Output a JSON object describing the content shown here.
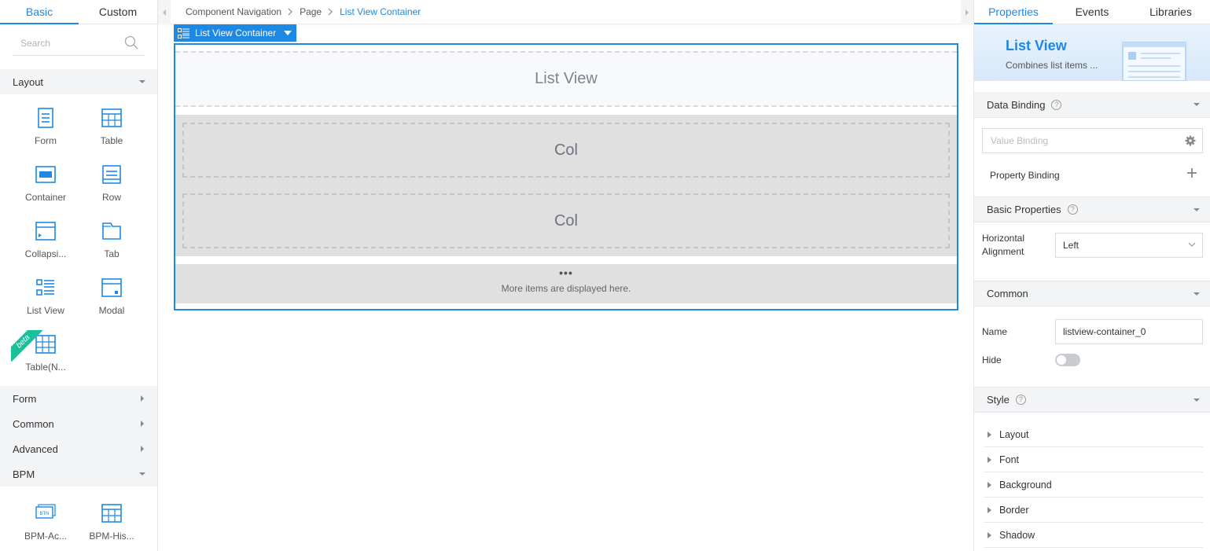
{
  "left": {
    "tabs": [
      {
        "label": "Basic"
      },
      {
        "label": "Custom"
      }
    ],
    "search": {
      "placeholder": "Search",
      "value": ""
    },
    "categories": {
      "layout": "Layout",
      "form": "Form",
      "common": "Common",
      "advanced": "Advanced",
      "bpm": "BPM"
    },
    "layout_items": [
      {
        "label": "Form",
        "icon": "form-icon"
      },
      {
        "label": "Table",
        "icon": "table-icon"
      },
      {
        "label": "Container",
        "icon": "container-icon"
      },
      {
        "label": "Row",
        "icon": "row-icon"
      },
      {
        "label": "Collapsi...",
        "icon": "collapsible-icon"
      },
      {
        "label": "Tab",
        "icon": "tab-icon"
      },
      {
        "label": "List View",
        "icon": "list-view-icon"
      },
      {
        "label": "Modal",
        "icon": "modal-icon"
      },
      {
        "label": "Table(N...",
        "icon": "table-new-icon",
        "badge": "beta"
      }
    ],
    "bpm_items": [
      {
        "label": "BPM-Ac...",
        "icon": "bpm-action-icon",
        "icon_text": "BTN"
      },
      {
        "label": "BPM-His...",
        "icon": "bpm-history-icon"
      }
    ]
  },
  "center": {
    "breadcrumb": [
      "Component Navigation",
      "Page",
      "List View Container"
    ],
    "selection_tag": "List View Container",
    "list_view_header": "List View",
    "cols": [
      "Col",
      "Col"
    ],
    "more_dots": "•••",
    "more_text": "More items are displayed here."
  },
  "right": {
    "tabs": [
      {
        "label": "Properties"
      },
      {
        "label": "Events"
      },
      {
        "label": "Libraries"
      }
    ],
    "banner": {
      "title": "List View",
      "subtitle": "Combines list items ..."
    },
    "data_binding": {
      "title": "Data Binding",
      "value_placeholder": "Value Binding",
      "property_binding": "Property Binding"
    },
    "basic_properties": {
      "title": "Basic Properties",
      "horizontal_alignment_label_1": "Horizontal",
      "horizontal_alignment_label_2": "Alignment",
      "horizontal_alignment_value": "Left"
    },
    "common": {
      "title": "Common",
      "name_label": "Name",
      "name_value": "listview-container_0",
      "hide_label": "Hide"
    },
    "style": {
      "title": "Style",
      "items": [
        "Layout",
        "Font",
        "Background",
        "Border",
        "Shadow"
      ]
    },
    "colors": {
      "accent": "#1e88e5",
      "beta": "#19c19a"
    }
  }
}
